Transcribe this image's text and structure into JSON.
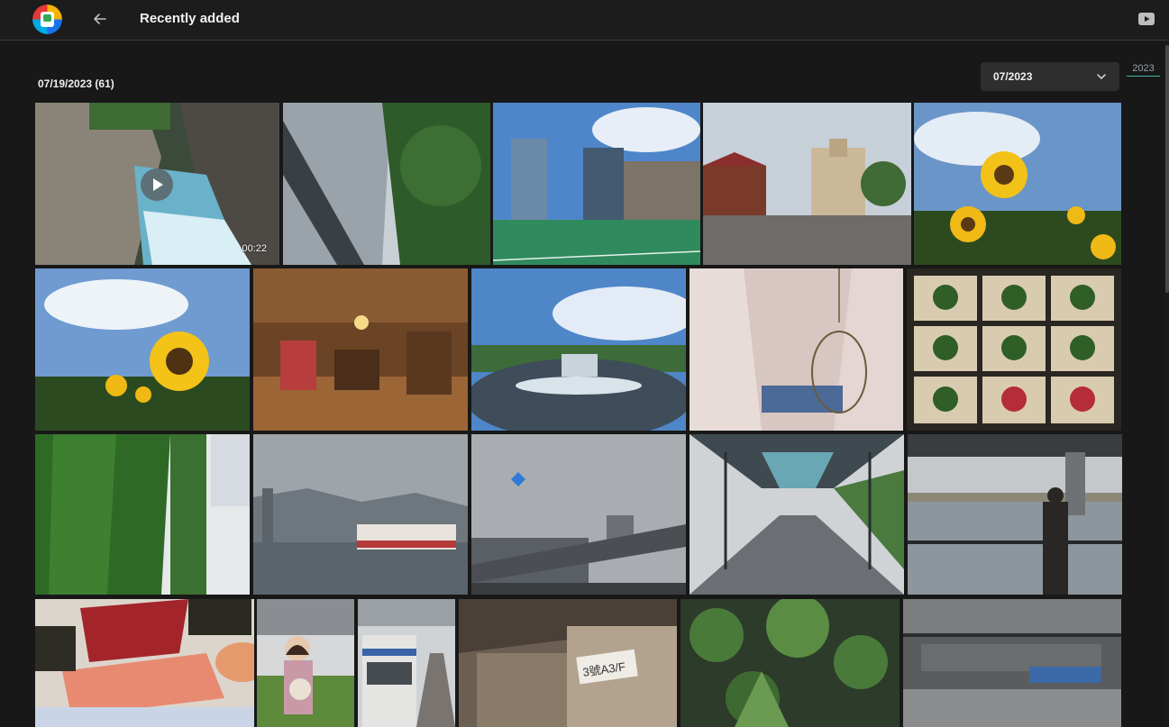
{
  "header": {
    "title": "Recently added"
  },
  "section": {
    "date_heading": "07/19/2023 (61)",
    "month_select": {
      "value": "07/2023"
    },
    "year_link": "2023"
  },
  "tiles": {
    "video_duration": "00:22",
    "sign_text": "3號A3/F"
  },
  "colors": {
    "background": "#181818",
    "topbar": "#1c1c1c",
    "accent": "#3fb8a0",
    "select_bg": "#2e2e2e"
  },
  "icons": [
    "app-logo-icon",
    "back-arrow-icon",
    "youtube-icon",
    "chevron-down-icon",
    "play-icon"
  ]
}
